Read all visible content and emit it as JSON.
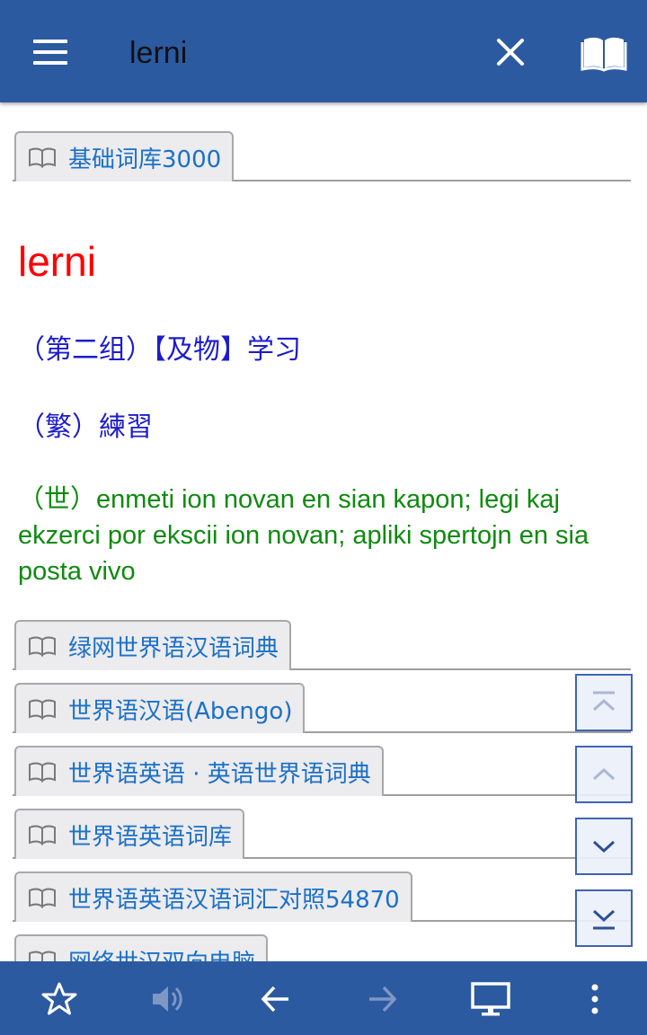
{
  "header": {
    "query": "lerni",
    "menu_icon": "hamburger-menu-icon",
    "close_icon": "close-icon",
    "dictionary_icon": "open-book-icon"
  },
  "dictionaries": {
    "first": "基础词库3000",
    "others": [
      "绿网世界语汉语词典",
      "世界语汉语(Abengo)",
      "世界语英语 · 英语世界语词典",
      "世界语英语词库",
      "世界语英语汉语词汇对照54870",
      "网络世汉双向电脑"
    ]
  },
  "entry": {
    "word": "lerni",
    "line1": "（第二组）【及物】学习",
    "line2": "（繁）練習",
    "line3": "（世）enmeti ion novan en sian kapon; legi kaj ekzerci por ekscii ion novan; apliki spertojn en sia posta vivo"
  },
  "scroll_buttons": [
    "scroll-to-top-icon",
    "scroll-up-icon",
    "scroll-down-icon",
    "scroll-to-bottom-icon"
  ],
  "bottom_bar": {
    "icons": [
      "star-icon",
      "speaker-icon",
      "back-arrow-icon",
      "forward-arrow-icon",
      "monitor-icon",
      "more-vert-icon"
    ],
    "disabled": [
      "speaker-icon",
      "forward-arrow-icon"
    ]
  },
  "colors": {
    "bar": "#2c5aa0",
    "headword": "#ff0000",
    "definition_blue": "#1c1ccc",
    "definition_green": "#0f8a0f",
    "dictionary_link": "#1a70c8"
  }
}
